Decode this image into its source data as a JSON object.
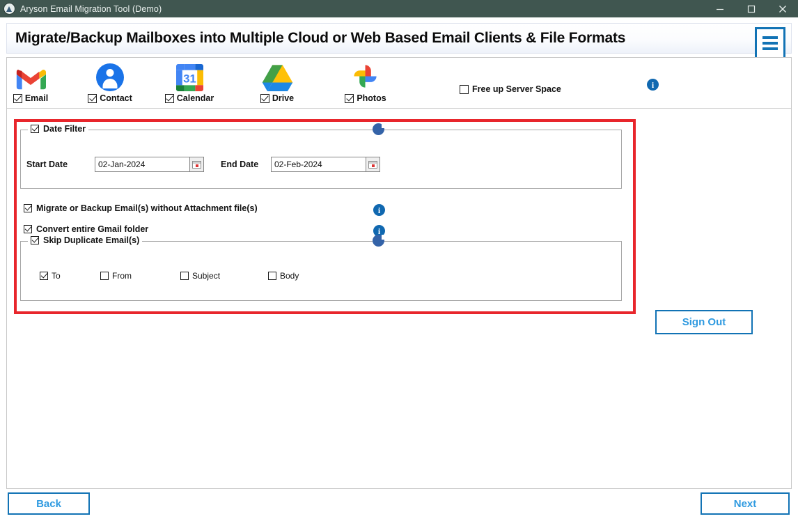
{
  "window": {
    "title": "Aryson Email Migration Tool (Demo)",
    "app_icon": "aryson-logo-icon",
    "minimize": "minimize-icon",
    "maximize": "maximize-icon",
    "close": "close-icon",
    "titlebar_color": "#405650"
  },
  "header": {
    "title": "Migrate/Backup Mailboxes into Multiple Cloud or Web Based Email Clients & File Formats",
    "menu_icon": "hamburger-menu-icon",
    "accent": "#1273b5"
  },
  "toolbar": {
    "services": [
      {
        "icon": "gmail-icon",
        "label": "Email",
        "checked": true
      },
      {
        "icon": "google-contacts-icon",
        "label": "Contact",
        "checked": true
      },
      {
        "icon": "google-calendar-icon",
        "label": "Calendar",
        "checked": true,
        "calendar_day": "31"
      },
      {
        "icon": "google-drive-icon",
        "label": "Drive",
        "checked": true
      },
      {
        "icon": "google-photos-icon",
        "label": "Photos",
        "checked": true
      }
    ],
    "free_up_server_space": {
      "label": "Free up Server Space",
      "checked": false
    },
    "info_icon": "info-icon"
  },
  "filters": {
    "highlight_color": "#e8262c",
    "date_filter": {
      "label": "Date Filter",
      "checked": true,
      "info_icon": "info-icon",
      "start": {
        "label": "Start Date",
        "value": "02-Jan-2024",
        "placeholder": "dd-MMM-yyyy",
        "picker_icon": "calendar-picker-icon"
      },
      "end": {
        "label": "End Date",
        "value": "02-Feb-2024",
        "placeholder": "dd-MMM-yyyy",
        "picker_icon": "calendar-picker-icon"
      }
    },
    "options": [
      {
        "label": "Migrate or Backup Email(s) without Attachment file(s)",
        "checked": true,
        "info_icon": "info-icon"
      },
      {
        "label": "Convert entire Gmail folder",
        "checked": true,
        "info_icon": "info-icon"
      }
    ],
    "skip_duplicate": {
      "label": "Skip Duplicate Email(s)",
      "checked": true,
      "info_icon": "info-icon",
      "criteria": [
        {
          "label": "To",
          "checked": true
        },
        {
          "label": "From",
          "checked": false
        },
        {
          "label": "Subject",
          "checked": false
        },
        {
          "label": "Body",
          "checked": false
        }
      ]
    }
  },
  "actions": {
    "sign_out": "Sign Out",
    "back": "Back",
    "next": "Next"
  }
}
